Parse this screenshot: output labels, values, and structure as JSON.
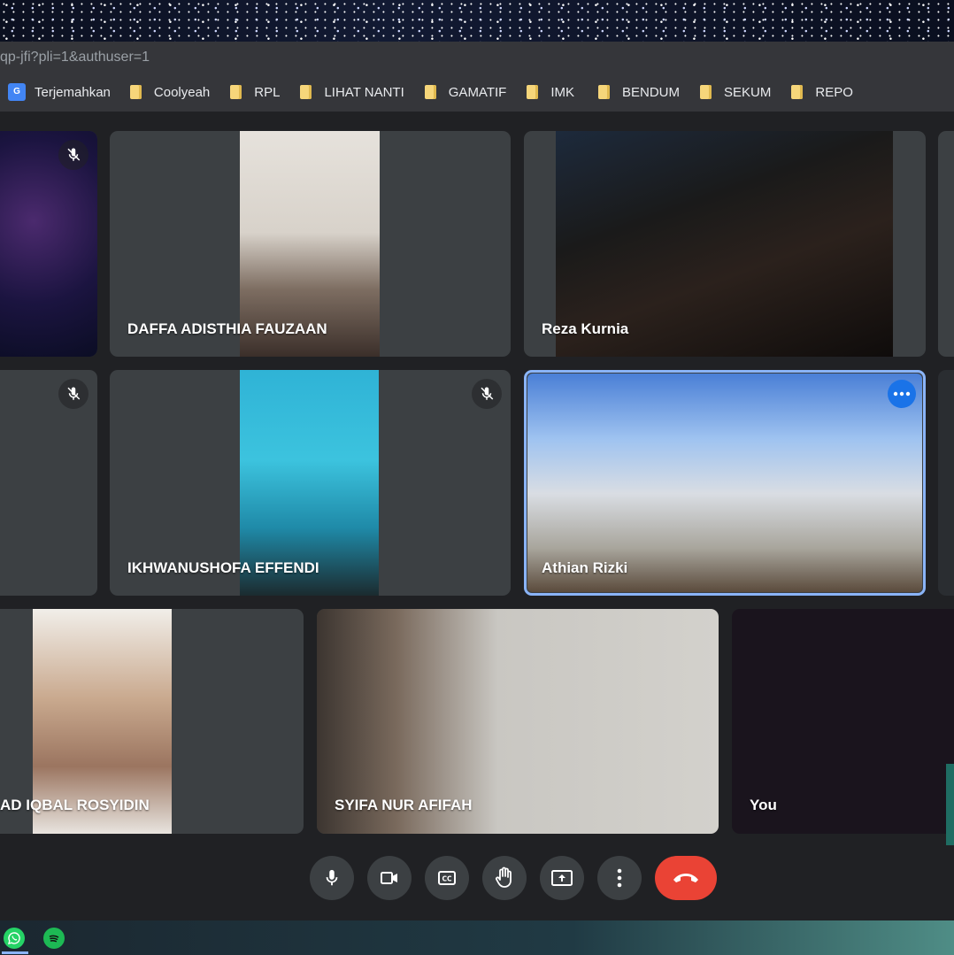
{
  "browser": {
    "url": "qp-jfi?pli=1&authuser=1",
    "bookmarks": [
      {
        "label": "Terjemahkan",
        "icon": "google-translate-icon"
      },
      {
        "label": "Coolyeah",
        "icon": "folder-icon"
      },
      {
        "label": "RPL",
        "icon": "folder-icon"
      },
      {
        "label": "LIHAT NANTI",
        "icon": "folder-icon"
      },
      {
        "label": "GAMATIF",
        "icon": "folder-icon"
      },
      {
        "label": "IMK",
        "icon": "folder-icon"
      },
      {
        "label": "BENDUM",
        "icon": "folder-icon"
      },
      {
        "label": "SEKUM",
        "icon": "folder-icon"
      },
      {
        "label": "REPO",
        "icon": "folder-icon"
      }
    ]
  },
  "participants": [
    {
      "name": "DAFFA ADISTHIA FAUZAAN"
    },
    {
      "name": "Reza Kurnia"
    },
    {
      "name": "IKHWANUSHOFA EFFENDI"
    },
    {
      "name": "Athian Rizki"
    },
    {
      "name": "AD IQBAL ROSYIDIN"
    },
    {
      "name": "SYIFA NUR AFIFAH"
    },
    {
      "name": "You"
    }
  ],
  "controls": {
    "items": [
      "microphone-icon",
      "camera-icon",
      "captions-icon",
      "raise-hand-icon",
      "present-screen-icon",
      "more-options-icon",
      "hang-up-icon"
    ]
  },
  "taskbar": {
    "apps": [
      "whatsapp-icon",
      "spotify-icon"
    ]
  },
  "colors": {
    "hangup": "#ea4335",
    "active_speaker_border": "#8ab4f8",
    "tile_bg": "#3c4043",
    "page_bg": "#202124"
  }
}
